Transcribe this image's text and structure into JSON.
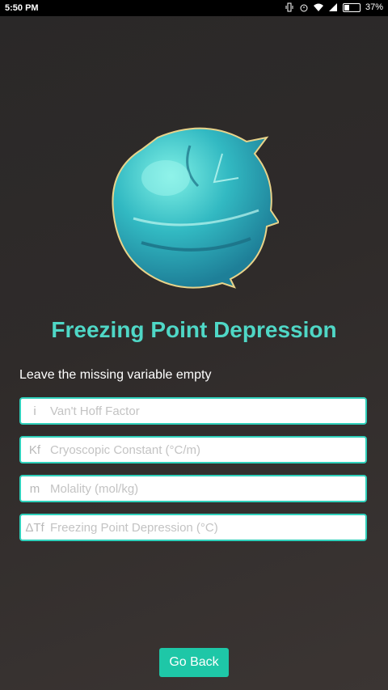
{
  "status_bar": {
    "time": "5:50 PM",
    "battery": "37%"
  },
  "title": "Freezing Point Depression",
  "subtitle": "Leave the missing variable empty",
  "fields": [
    {
      "prefix": "i",
      "placeholder": "Van't Hoff Factor"
    },
    {
      "prefix": "Kf",
      "placeholder": "Cryoscopic Constant (°C/m)"
    },
    {
      "prefix": "m",
      "placeholder": "Molality (mol/kg)"
    },
    {
      "prefix": "ΔTf",
      "placeholder": "Freezing Point Depression (°C)"
    }
  ],
  "go_back_label": "Go Back",
  "colors": {
    "accent": "#4fd7c6",
    "button": "#1ec7a7",
    "field_border": "#2fd0bb"
  },
  "icons": {
    "logo": "ice-ball-icon"
  }
}
